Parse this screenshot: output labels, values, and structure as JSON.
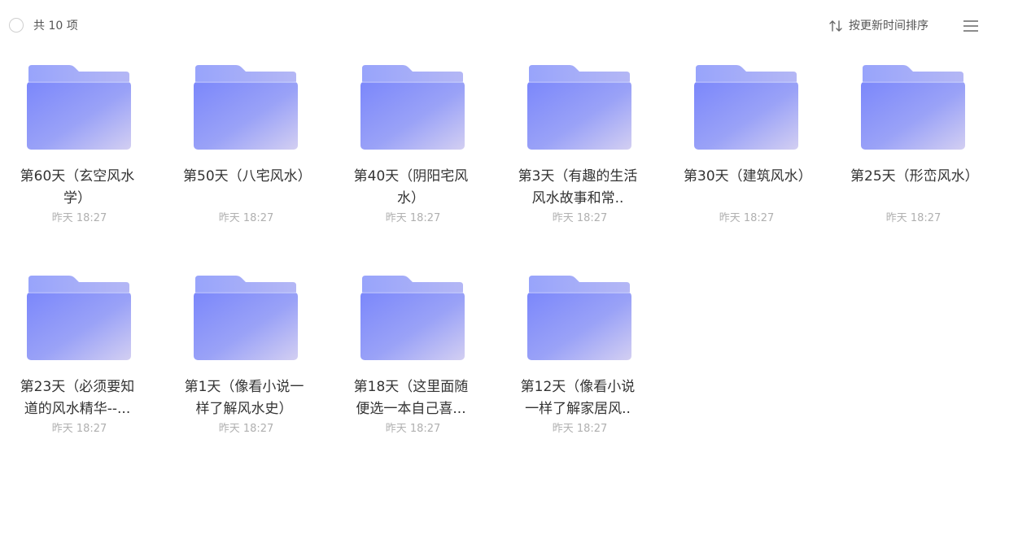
{
  "toolbar": {
    "count_label": "共 10 项",
    "sort_label": "按更新时间排序",
    "sort_icon": "sort-arrows-icon",
    "view_icon": "list-view-icon"
  },
  "colors": {
    "folder_back": "#9ba7fb",
    "folder_front_start": "#7b87fb",
    "folder_front_end": "#cdcaf3",
    "time_text": "#b0b0b0"
  },
  "files": [
    {
      "name": "第60天（玄空风水学）",
      "time": "昨天 18:27"
    },
    {
      "name": "第50天（八宅风水）",
      "time": "昨天 18:27"
    },
    {
      "name": "第40天（阴阳宅风水）",
      "time": "昨天 18:27"
    },
    {
      "name": "第3天（有趣的生活风水故事和常..",
      "time": "昨天 18:27"
    },
    {
      "name": "第30天（建筑风水）",
      "time": "昨天 18:27"
    },
    {
      "name": "第25天（形峦风水）",
      "time": "昨天 18:27"
    },
    {
      "name": "第23天（必须要知道的风水精华--...",
      "time": "昨天 18:27"
    },
    {
      "name": "第1天（像看小说一样了解风水史）",
      "time": "昨天 18:27"
    },
    {
      "name": "第18天（这里面随便选一本自己喜...",
      "time": "昨天 18:27"
    },
    {
      "name": "第12天（像看小说一样了解家居风..",
      "time": "昨天 18:27"
    }
  ]
}
